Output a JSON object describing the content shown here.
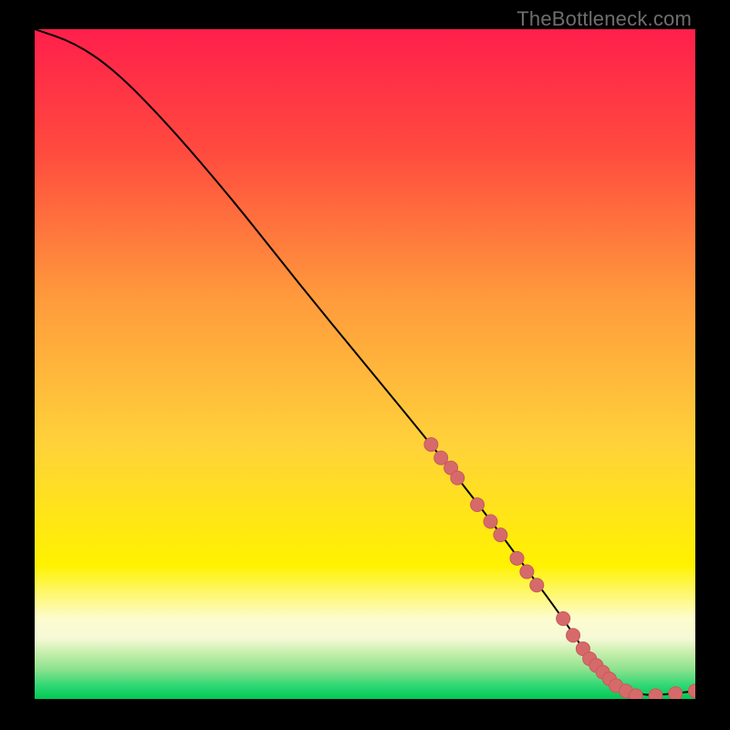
{
  "watermark": "TheBottleneck.com",
  "colors": {
    "dot_fill": "#d66a6a",
    "dot_stroke": "#c85a5a",
    "line": "#000000",
    "green_band_top": "#8fe28f",
    "green_band_bottom": "#00c853"
  },
  "chart_data": {
    "type": "line",
    "title": "",
    "xlabel": "",
    "ylabel": "",
    "xlim": [
      0,
      100
    ],
    "ylim": [
      0,
      100
    ],
    "series": [
      {
        "name": "bottleneck-curve",
        "x": [
          0,
          6,
          12,
          20,
          30,
          40,
          50,
          60,
          68,
          74,
          80,
          84,
          88,
          92,
          96,
          100
        ],
        "y": [
          100,
          98,
          94,
          86,
          74.5,
          62,
          50,
          38,
          28,
          20,
          12,
          6,
          2,
          0.5,
          0.7,
          1.2
        ]
      }
    ],
    "marker_points": {
      "name": "highlighted-range",
      "x": [
        60,
        61.5,
        63,
        64,
        67,
        69,
        70.5,
        73,
        74.5,
        76,
        80,
        81.5,
        83,
        84,
        85,
        86,
        87,
        88,
        89.5,
        91,
        94,
        97,
        100
      ],
      "y": [
        38,
        36,
        34.5,
        33,
        29,
        26.5,
        24.5,
        21,
        19,
        17,
        12,
        9.5,
        7.5,
        6,
        5,
        4,
        3,
        2,
        1.2,
        0.5,
        0.5,
        0.8,
        1.2
      ]
    },
    "gradient_stops": [
      {
        "pct": 0,
        "color": "#ff1f4b"
      },
      {
        "pct": 18,
        "color": "#ff4a3f"
      },
      {
        "pct": 40,
        "color": "#ff9a3c"
      },
      {
        "pct": 62,
        "color": "#ffd23a"
      },
      {
        "pct": 80,
        "color": "#fff200"
      },
      {
        "pct": 88,
        "color": "#fdfccf"
      },
      {
        "pct": 91,
        "color": "#f6f9d6"
      },
      {
        "pct": 93,
        "color": "#c8efae"
      },
      {
        "pct": 95.5,
        "color": "#8fe28f"
      },
      {
        "pct": 98,
        "color": "#2fd874"
      },
      {
        "pct": 100,
        "color": "#00c853"
      }
    ]
  }
}
